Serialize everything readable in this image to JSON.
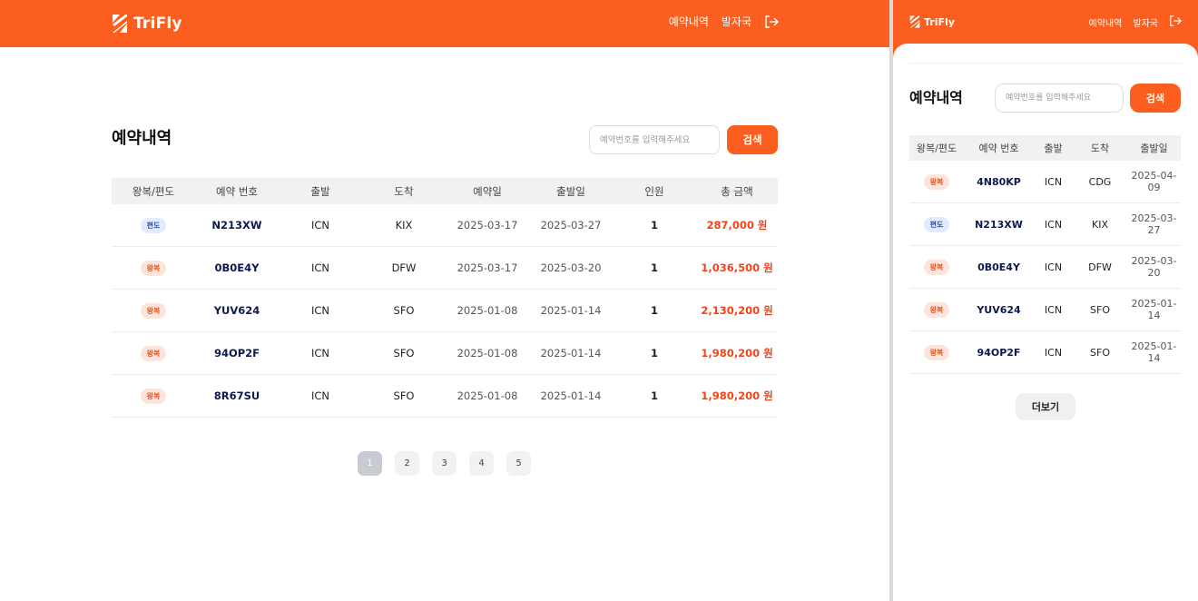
{
  "brand": {
    "name": "TriFly",
    "color": "#fb5e1e"
  },
  "nav": {
    "reservations": "예약내역",
    "issuing_country": "발자국"
  },
  "page": {
    "title": "예약내역",
    "search_placeholder": "예약번호를 입력해주세요",
    "search_button": "검색"
  },
  "desktop_table": {
    "headers": [
      "왕복/편도",
      "예약 번호",
      "출발",
      "도착",
      "예약일",
      "출발일",
      "인원",
      "총 금액"
    ],
    "rows": [
      {
        "trip": "편도",
        "trip_kind": "oneway",
        "pnr": "N213XW",
        "from": "ICN",
        "to": "KIX",
        "booked": "2025-03-17",
        "depart": "2025-03-27",
        "pax": "1",
        "total": "287,000 원"
      },
      {
        "trip": "왕복",
        "trip_kind": "round",
        "pnr": "0B0E4Y",
        "from": "ICN",
        "to": "DFW",
        "booked": "2025-03-17",
        "depart": "2025-03-20",
        "pax": "1",
        "total": "1,036,500 원"
      },
      {
        "trip": "왕복",
        "trip_kind": "round",
        "pnr": "YUV624",
        "from": "ICN",
        "to": "SFO",
        "booked": "2025-01-08",
        "depart": "2025-01-14",
        "pax": "1",
        "total": "2,130,200 원"
      },
      {
        "trip": "왕복",
        "trip_kind": "round",
        "pnr": "94OP2F",
        "from": "ICN",
        "to": "SFO",
        "booked": "2025-01-08",
        "depart": "2025-01-14",
        "pax": "1",
        "total": "1,980,200 원"
      },
      {
        "trip": "왕복",
        "trip_kind": "round",
        "pnr": "8R67SU",
        "from": "ICN",
        "to": "SFO",
        "booked": "2025-01-08",
        "depart": "2025-01-14",
        "pax": "1",
        "total": "1,980,200 원"
      }
    ]
  },
  "pagination": {
    "pages": [
      "1",
      "2",
      "3",
      "4",
      "5"
    ],
    "current": "1"
  },
  "mobile": {
    "headers": [
      "왕복/편도",
      "예약 번호",
      "출발",
      "도착",
      "출발일"
    ],
    "rows": [
      {
        "trip": "왕복",
        "trip_kind": "round",
        "pnr": "4N80KP",
        "from": "ICN",
        "to": "CDG",
        "depart": "2025-04-09"
      },
      {
        "trip": "편도",
        "trip_kind": "oneway",
        "pnr": "N213XW",
        "from": "ICN",
        "to": "KIX",
        "depart": "2025-03-27"
      },
      {
        "trip": "왕복",
        "trip_kind": "round",
        "pnr": "0B0E4Y",
        "from": "ICN",
        "to": "DFW",
        "depart": "2025-03-20"
      },
      {
        "trip": "왕복",
        "trip_kind": "round",
        "pnr": "YUV624",
        "from": "ICN",
        "to": "SFO",
        "depart": "2025-01-14"
      },
      {
        "trip": "왕복",
        "trip_kind": "round",
        "pnr": "94OP2F",
        "from": "ICN",
        "to": "SFO",
        "depart": "2025-01-14"
      }
    ],
    "more_button": "더보기"
  },
  "icons": {
    "logo": "trifly-logo-icon",
    "logout": "logout-icon"
  }
}
